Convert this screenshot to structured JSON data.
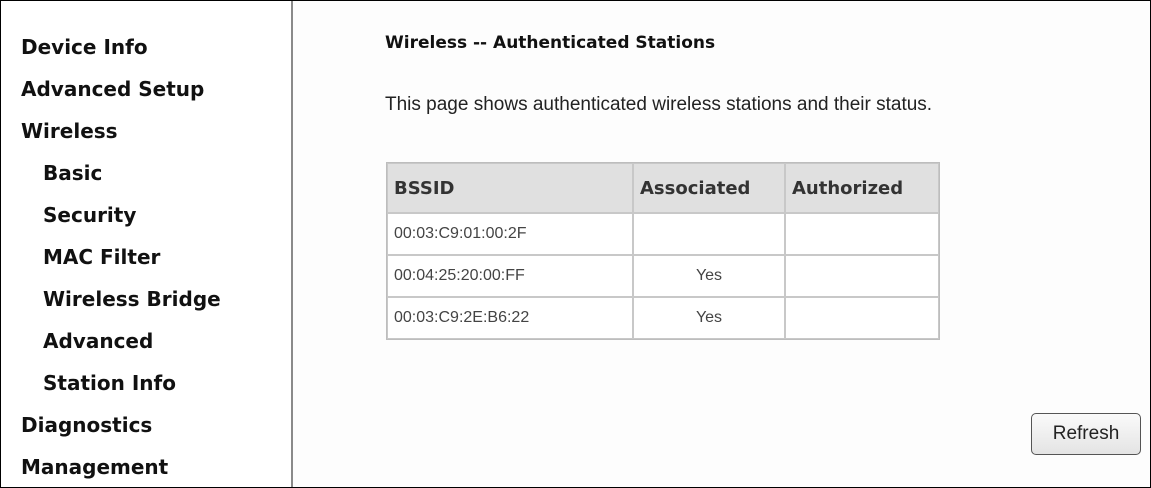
{
  "sidebar": {
    "items": [
      {
        "label": "Device Info"
      },
      {
        "label": "Advanced Setup"
      },
      {
        "label": "Wireless"
      },
      {
        "label": "Basic"
      },
      {
        "label": "Security"
      },
      {
        "label": "MAC Filter"
      },
      {
        "label": "Wireless Bridge"
      },
      {
        "label": "Advanced"
      },
      {
        "label": "Station Info"
      },
      {
        "label": "Diagnostics"
      },
      {
        "label": "Management"
      }
    ]
  },
  "main": {
    "title": "Wireless -- Authenticated Stations",
    "description": "This page shows authenticated wireless stations and their status.",
    "table": {
      "headers": [
        "BSSID",
        "Associated",
        "Authorized"
      ],
      "rows": [
        {
          "bssid": "00:03:C9:01:00:2F",
          "associated": "",
          "authorized": ""
        },
        {
          "bssid": "00:04:25:20:00:FF",
          "associated": "Yes",
          "authorized": ""
        },
        {
          "bssid": "00:03:C9:2E:B6:22",
          "associated": "Yes",
          "authorized": ""
        }
      ]
    },
    "refresh_label": "Refresh"
  }
}
